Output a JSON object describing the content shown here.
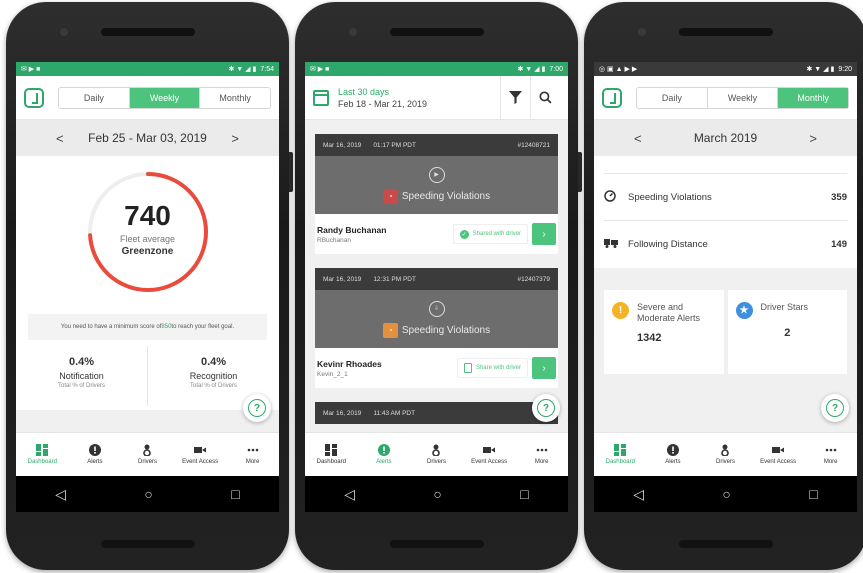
{
  "phone1": {
    "status_time": "7:54",
    "tabs": [
      "Daily",
      "Weekly",
      "Monthly"
    ],
    "active_tab": 1,
    "date_range": "Feb 25 - Mar 03, 2019",
    "score": "740",
    "score_label": "Fleet average",
    "score_zone": "Greenzone",
    "score_fraction": 0.74,
    "goal_note_pre": "You need to have a minimum score of ",
    "goal_score": "850",
    "goal_note_post": " to reach your fleet goal.",
    "stats": [
      {
        "value": "0.4%",
        "label": "Notification",
        "sub": "Total % of Drivers"
      },
      {
        "value": "0.4%",
        "label": "Recognition",
        "sub": "Total % of Drivers"
      }
    ],
    "active_nav": 0
  },
  "phone2": {
    "status_time": "7:00",
    "range_title": "Last 30 days",
    "range_dates": "Feb 18 - Mar 21, 2019",
    "cards": [
      {
        "date": "Mar 16, 2019",
        "time": "01:17 PM PDT",
        "id": "#12408721",
        "violation": "Speeding Violations",
        "badge_color": "#c94a4a",
        "driver": "Randy Buchanan",
        "user": "RBuchanan",
        "share": "Shared with driver",
        "shared": true
      },
      {
        "date": "Mar 16, 2019",
        "time": "12:31 PM PDT",
        "id": "#12407379",
        "violation": "Speeding Violations",
        "badge_color": "#e3913e",
        "driver": "Kevinr Rhoades",
        "user": "Kevin_2_1",
        "share": "Share with driver",
        "shared": false
      },
      {
        "date": "Mar 16, 2019",
        "time": "11:43 AM PDT",
        "id": "#124"
      }
    ],
    "active_nav": 1
  },
  "phone3": {
    "status_time": "9:20",
    "tabs": [
      "Daily",
      "Weekly",
      "Monthly"
    ],
    "active_tab": 2,
    "date_range": "March 2019",
    "rows": [
      {
        "icon": "speedometer-icon",
        "label": "Speeding Violations",
        "value": "359"
      },
      {
        "icon": "truck-icon",
        "label": "Following Distance",
        "value": "149"
      }
    ],
    "tiles": [
      {
        "label": "Severe and Moderate Alerts",
        "value": "1342",
        "color": "#f5b323"
      },
      {
        "label": "Driver Stars",
        "value": "2",
        "color": "#3d8fe0"
      }
    ],
    "active_nav": 0
  },
  "nav": [
    "Dashboard",
    "Alerts",
    "Drivers",
    "Event Access",
    "More"
  ],
  "colors": {
    "brand": "#2ea86a",
    "accent": "#4cc47d",
    "gauge": "#e94b3c"
  }
}
